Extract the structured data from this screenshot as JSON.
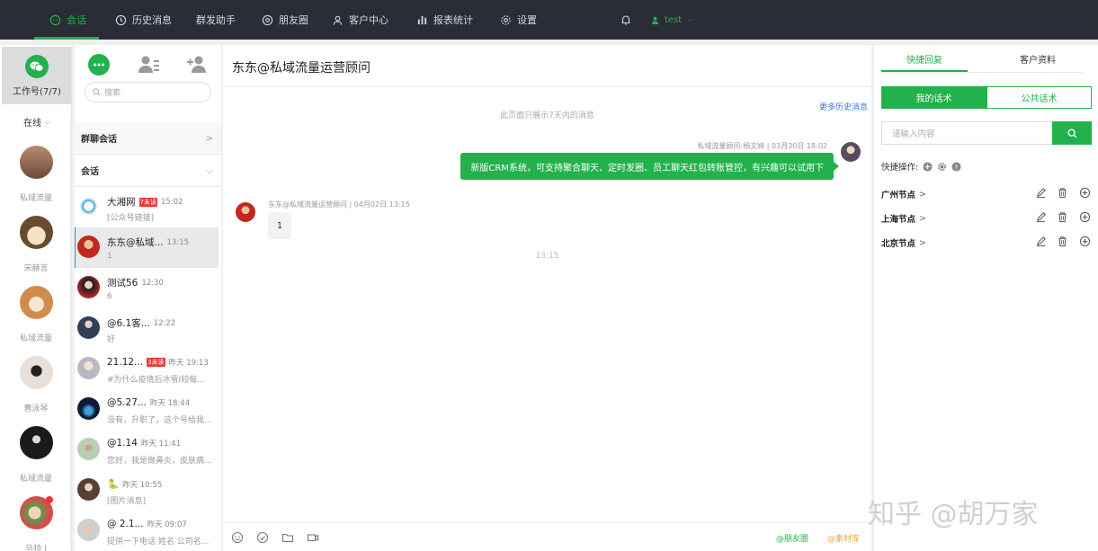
{
  "nav": {
    "items": [
      {
        "label": "会话",
        "icon": "chat-icon"
      },
      {
        "label": "历史消息",
        "icon": "clock-icon"
      },
      {
        "label": "群发助手",
        "icon": ""
      },
      {
        "label": "朋友圈",
        "icon": "moments-icon"
      },
      {
        "label": "客户中心",
        "icon": "user-icon"
      },
      {
        "label": "报表统计",
        "icon": "bar-chart-icon"
      },
      {
        "label": "设置",
        "icon": "gear-icon"
      }
    ],
    "user": "test",
    "accent": "#22b14c",
    "bg": "#2b2d36"
  },
  "accounts": {
    "tile_label": "工作号(7/7)",
    "status": "在线",
    "list": [
      "私域流量",
      "宋赫言",
      "私域流量",
      "曹泳琴",
      "私域流量",
      "马帅 |"
    ]
  },
  "sessions": {
    "search_placeholder": "搜索",
    "group_section": "群聊会话",
    "conv_section": "会话",
    "items": [
      {
        "name": "大湘网",
        "tag": "7未读",
        "time": "15:02",
        "preview": "[公众号链接]"
      },
      {
        "name": "东东@私域...",
        "tag": "",
        "time": "13:15",
        "preview": "1"
      },
      {
        "name": "测试56",
        "tag": "",
        "time": "12:30",
        "preview": "6"
      },
      {
        "name": "@6.1客...",
        "tag": "",
        "time": "12:22",
        "preview": "好"
      },
      {
        "name": "21.12...",
        "tag": "3未读",
        "time": "昨天 19:13",
        "preview": "#为什么疫情后冰雪Ⅰ较每..."
      },
      {
        "name": "@5.27...",
        "tag": "",
        "time": "昨天 18:44",
        "preview": "没有，升职了，这个号给我..."
      },
      {
        "name": "@1.14",
        "tag": "",
        "time": "昨天 11:41",
        "preview": "您好，我是做鼻炎，皮肤病..."
      },
      {
        "name": "🐍",
        "tag": "",
        "time": "昨天 10:55",
        "preview": "[图片消息]"
      },
      {
        "name": "@ 2.1...",
        "tag": "",
        "time": "昨天 09:07",
        "preview": "提供一下电话 姓名 公司名..."
      }
    ]
  },
  "chat": {
    "title": "东东@私域流量运营顾问",
    "history_note": "此页面只展示7天内的消息",
    "more_history": "更多历史消息",
    "out_meta": "私域流量顾问-杨文婷 | 03月30日 18:02",
    "out_text": "新版CRM系统，可支持聚合聊天、定时发圈、员工聊天红包转账管控，有兴趣可以试用下",
    "in_meta": "东东@私域流量运营顾问 | 04月02日 13:15",
    "in_text": "1",
    "time_center": "13:15",
    "toolbar_moments": "@朋友圈",
    "toolbar_materials": "@素材库"
  },
  "right": {
    "tab_quick": "快捷回复",
    "tab_profile": "客户资料",
    "seg_mine": "我的话术",
    "seg_public": "公共话术",
    "input_placeholder": "请输入内容",
    "quick_ops": "快捷操作:",
    "nodes": [
      "广州节点",
      "上海节点",
      "北京节点"
    ]
  },
  "watermark": "知乎 @胡万家"
}
